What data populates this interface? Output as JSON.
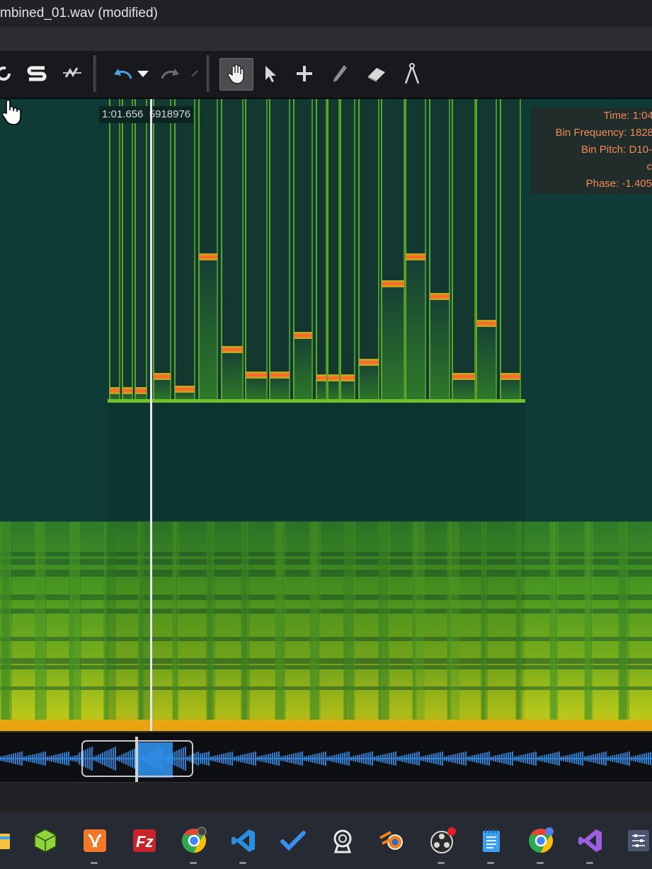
{
  "window": {
    "title": "mbined_01.wav (modified)"
  },
  "toolbar": {
    "items": [
      {
        "icon": "loop-icon"
      },
      {
        "icon": "snap-icon"
      },
      {
        "icon": "snap-zero-icon"
      },
      {
        "icon": "undo-icon"
      },
      {
        "icon": "undo-dropdown-icon"
      },
      {
        "icon": "redo-icon"
      },
      {
        "icon": "redo-dropdown-icon"
      },
      {
        "icon": "hand-tool-icon",
        "active": true
      },
      {
        "icon": "select-arrow-icon"
      },
      {
        "icon": "move-cross-icon"
      },
      {
        "icon": "pencil-icon"
      },
      {
        "icon": "eraser-icon"
      },
      {
        "icon": "compass-icon"
      }
    ]
  },
  "spectrogram": {
    "cursor_time": "1:01.656",
    "cursor_sample": "5918976",
    "info": {
      "time": "Time: 1:04.",
      "bin_frequency": "Bin Frequency: 1828",
      "bin_pitch": "Bin Pitch: D10-",
      "extra": "c",
      "phase": "Phase: -1.405"
    },
    "colors": {
      "background": "#0f3b37",
      "bright": "#c8d21a",
      "line": "#ff6a2a",
      "playhead": "#e8e8e8"
    }
  },
  "taskbar": {
    "apps": [
      {
        "icon": "file-explorer-icon"
      },
      {
        "icon": "3d-viewer-icon"
      },
      {
        "icon": "xampp-icon"
      },
      {
        "icon": "filezilla-icon"
      },
      {
        "icon": "chrome-icon"
      },
      {
        "icon": "vscode-icon"
      },
      {
        "icon": "todo-icon"
      },
      {
        "icon": "audio-app-icon"
      },
      {
        "icon": "blender-icon"
      },
      {
        "icon": "obs-icon"
      },
      {
        "icon": "notepad-icon"
      },
      {
        "icon": "chrome-profile-icon"
      },
      {
        "icon": "visual-studio-icon"
      },
      {
        "icon": "settings-mixer-icon"
      }
    ]
  }
}
